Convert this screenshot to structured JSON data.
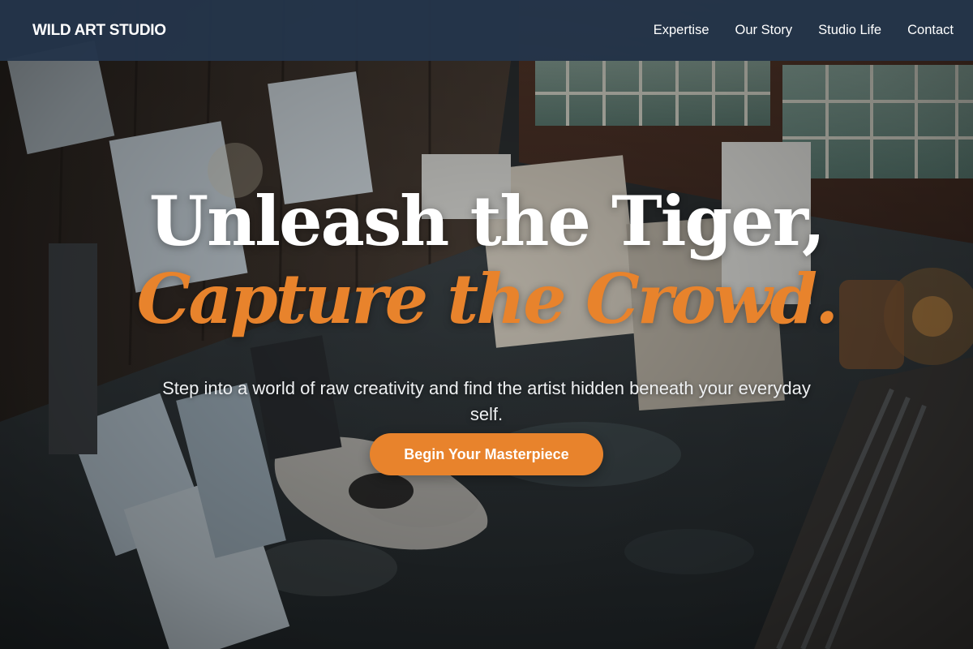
{
  "navbar": {
    "brand": "WILD ART STUDIO",
    "links": [
      "Expertise",
      "Our Story",
      "Studio Life",
      "Contact"
    ]
  },
  "hero": {
    "headline_line1": "Unleash the Tiger,",
    "headline_line2": "Capture the Crowd.",
    "subtitle": "Step into a world of raw creativity and find the artist hidden beneath your everyday self.",
    "cta_label": "Begin Your Masterpiece"
  },
  "colors": {
    "navbar_bg": "#24354a",
    "accent": "#e8832c",
    "text": "#ffffff"
  },
  "background_image": "art-studio-photo"
}
